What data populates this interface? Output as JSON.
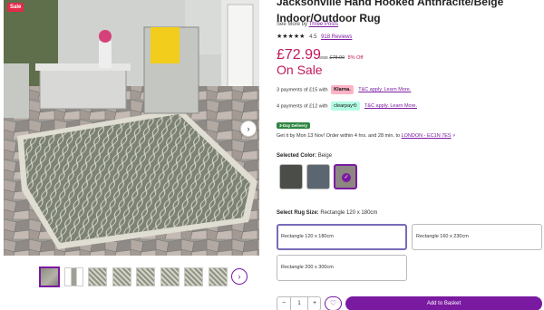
{
  "gallery": {
    "sale_badge": "Sale",
    "next_arrow": "›",
    "thumb_next_arrow": "›",
    "thumbnail_count": 8,
    "selected_thumbnail": 1
  },
  "product": {
    "title_line1": "Jacksonville Hand Hooked Anthracite/Beige",
    "title_line2": "Indoor/Outdoor Rug",
    "see_more_prefix": "See More by",
    "brand": "Three Posts",
    "stars": "★★★★★",
    "rating": "4.5",
    "reviews": "918 Reviews"
  },
  "pricing": {
    "price": "£72.99",
    "was_label": "was",
    "was_price": "£78.99",
    "discount": "8% Off",
    "on_sale": "On Sale"
  },
  "payments": [
    {
      "text": "3 payments of £15 with",
      "provider": "Klarna.",
      "link": "T&C apply. Learn More."
    },
    {
      "text": "4 payments of £12 with",
      "provider": "clearpay⟲",
      "link": "T&C apply. Learn More."
    }
  ],
  "delivery": {
    "badge": "3-Day Delivery",
    "text": "Get it by Mon 13 Nov! Order within 4 hrs. and 28 min. to",
    "location": "LONDON - EC1N 7ES",
    "chevron": "˅"
  },
  "color": {
    "label": "Selected Color:",
    "value": "Beige",
    "check": "✓",
    "swatch_colors": [
      "#4a4d48",
      "#5c6670",
      "#8c8780"
    ],
    "selected_index": 2
  },
  "size": {
    "label": "Select Rug Size:",
    "value": "Rectangle 120 x 180cm",
    "options": [
      "Rectangle 120 x 180cm",
      "Rectangle 160 x 230cm",
      "Rectangle 200 x 300cm"
    ],
    "selected_index": 0
  },
  "purchase": {
    "minus": "−",
    "quantity": "1",
    "plus": "+",
    "wishlist": "♡",
    "add_to_basket": "Add to Basket"
  },
  "colors": {
    "accent": "#7a1aa0",
    "sale_pink": "#c2185b",
    "delivery_green": "#2e8540"
  }
}
